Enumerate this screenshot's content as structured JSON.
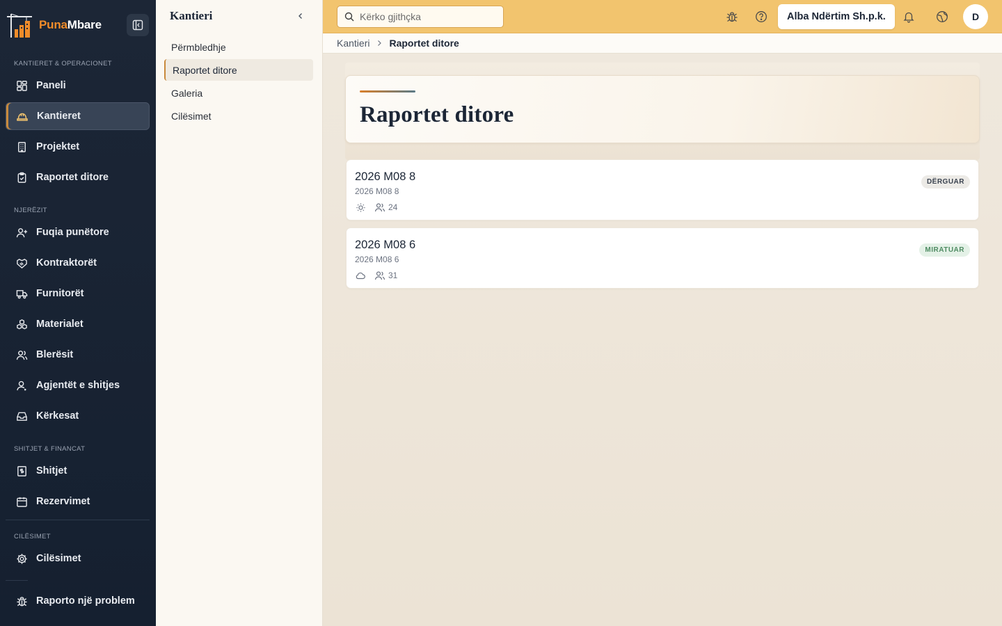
{
  "brand": {
    "name_part1": "Puna",
    "name_part2": "Mbare"
  },
  "sidebar": {
    "sections": [
      {
        "label": "KANTIERET & OPERACIONET"
      },
      {
        "label": "NJERËZIT"
      },
      {
        "label": "SHITJET & FINANCAT"
      },
      {
        "label": "CILËSIMET"
      }
    ],
    "items": [
      {
        "label": "Paneli",
        "icon": "dashboard-icon"
      },
      {
        "label": "Kantieret",
        "icon": "hard-hat-icon",
        "active": true
      },
      {
        "label": "Projektet",
        "icon": "building-icon"
      },
      {
        "label": "Raportet ditore",
        "icon": "clipboard-check-icon"
      },
      {
        "label": "Fuqia punëtore",
        "icon": "user-plus-icon"
      },
      {
        "label": "Kontraktorët",
        "icon": "handshake-icon"
      },
      {
        "label": "Furnitorët",
        "icon": "truck-icon"
      },
      {
        "label": "Materialet",
        "icon": "boxes-icon"
      },
      {
        "label": "Blerësit",
        "icon": "users-icon"
      },
      {
        "label": "Agjentët e shitjes",
        "icon": "user-icon"
      },
      {
        "label": "Kërkesat",
        "icon": "inbox-icon"
      },
      {
        "label": "Shitjet",
        "icon": "receipt-icon"
      },
      {
        "label": "Rezervimet",
        "icon": "calendar-icon"
      },
      {
        "label": "Cilësimet",
        "icon": "gear-icon"
      }
    ],
    "report_problem": "Raporto një problem"
  },
  "subpanel": {
    "title": "Kantieri",
    "items": [
      {
        "label": "Përmbledhje"
      },
      {
        "label": "Raportet ditore",
        "active": true
      },
      {
        "label": "Galeria"
      },
      {
        "label": "Cilësimet"
      }
    ]
  },
  "topbar": {
    "search_placeholder": "Kërko gjithçka",
    "company": "Alba Ndërtim Sh.p.k.",
    "avatar_initial": "D"
  },
  "breadcrumb": {
    "parent": "Kantieri",
    "current": "Raportet ditore"
  },
  "page": {
    "title": "Raportet ditore"
  },
  "reports": [
    {
      "title": "2026 M08 8",
      "subtitle": "2026 M08 8",
      "weather": "sun-icon",
      "workers": "24",
      "status": "DËRGUAR",
      "status_color": "#eceae6"
    },
    {
      "title": "2026 M08 6",
      "subtitle": "2026 M08 6",
      "weather": "cloud-icon",
      "workers": "31",
      "status": "MIRATUAR",
      "status_color": "#e4f1e7"
    }
  ],
  "colors": {
    "accent": "#c98a3c",
    "topbar": "#f2c46e",
    "sidebar": "#1c2636",
    "brand_orange": "#f08c2a"
  }
}
